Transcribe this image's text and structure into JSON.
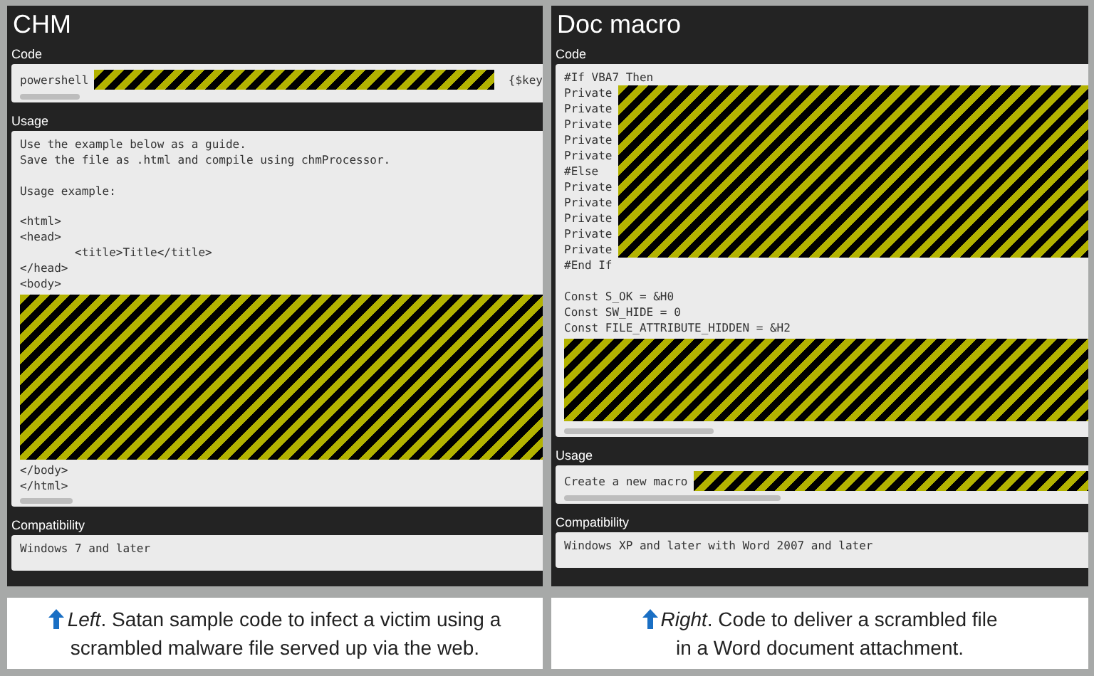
{
  "panels": [
    {
      "title": "CHM",
      "sections": [
        {
          "heading": "Code",
          "blocks": [
            {
              "kind": "inline",
              "text": "powershell",
              "tail": "{$key"
            }
          ]
        },
        {
          "heading": "Usage",
          "blocks": [
            {
              "kind": "lines",
              "lines": [
                "Use the example below as a guide.",
                "Save the file as .html and compile using chmProcessor."
              ]
            },
            {
              "kind": "gap"
            },
            {
              "kind": "lines",
              "lines": [
                "Usage example:"
              ]
            },
            {
              "kind": "gap"
            },
            {
              "kind": "lines",
              "lines": [
                "<html>",
                "<head>",
                "        <title>Title</title>",
                "</head>",
                "<body>"
              ]
            },
            {
              "kind": "redacted"
            },
            {
              "kind": "lines",
              "lines": [
                "</body>",
                "</html>"
              ]
            }
          ]
        },
        {
          "heading": "Compatibility",
          "blocks": [
            {
              "kind": "lines",
              "lines": [
                "Windows 7 and later"
              ]
            }
          ]
        }
      ],
      "caption": "*Left*. Satan sample code to infect a victim using a scrambled malware file served up via the web."
    },
    {
      "title": "Doc macro",
      "sections": [
        {
          "heading": "Code",
          "blocks": [
            {
              "kind": "lines",
              "lines": [
                "#If VBA7 Then"
              ]
            },
            {
              "kind": "side",
              "lines": [
                "Private",
                "Private",
                "Private",
                "Private",
                "Private",
                "#Else",
                "Private",
                "Private",
                "Private",
                "Private",
                "Private"
              ]
            },
            {
              "kind": "lines",
              "lines": [
                "#End If"
              ]
            },
            {
              "kind": "gap"
            },
            {
              "kind": "lines",
              "lines": [
                "Const S_OK = &H0",
                "Const SW_HIDE = 0",
                "Const FILE_ATTRIBUTE_HIDDEN = &H2"
              ]
            },
            {
              "kind": "redacted"
            }
          ]
        },
        {
          "heading": "Usage",
          "blocks": [
            {
              "kind": "inline",
              "text": "Create a new macro"
            }
          ]
        },
        {
          "heading": "Compatibility",
          "blocks": [
            {
              "kind": "lines",
              "lines": [
                "Windows XP and later with Word 2007 and later"
              ]
            }
          ]
        }
      ],
      "caption": "*Right*. Code to deliver a scrambled file in a Word document attachment."
    }
  ]
}
